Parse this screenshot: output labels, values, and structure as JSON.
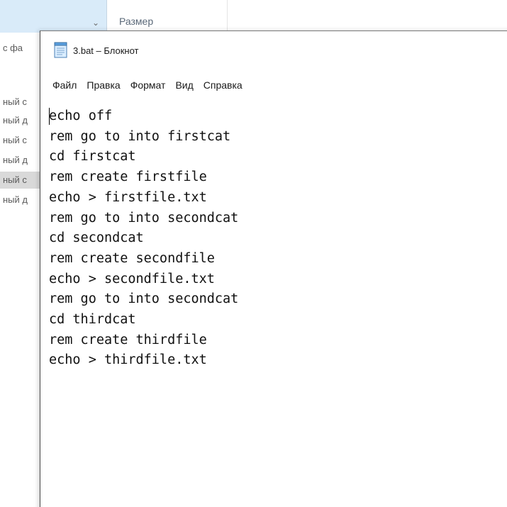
{
  "explorer": {
    "column_size_label": "Размер",
    "left_label": "с фа",
    "rows": [
      {
        "text": "ный с",
        "selected": false
      },
      {
        "text": "ный д",
        "selected": false
      },
      {
        "text": "ный с",
        "selected": false
      },
      {
        "text": "ный д",
        "selected": false
      },
      {
        "text": "ный с",
        "selected": true
      },
      {
        "text": "ный д",
        "selected": false
      }
    ]
  },
  "notepad": {
    "title": "3.bat – Блокнот",
    "menu": [
      {
        "label": "Файл"
      },
      {
        "label": "Правка"
      },
      {
        "label": "Формат"
      },
      {
        "label": "Вид"
      },
      {
        "label": "Справка"
      }
    ],
    "content": "echo off\nrem go to into firstcat\ncd firstcat\nrem create firstfile\necho > firstfile.txt\nrem go to into secondcat\ncd secondcat\nrem create secondfile\necho > secondfile.txt\nrem go to into secondcat\ncd thirdcat\nrem create thirdfile\necho > thirdfile.txt"
  }
}
